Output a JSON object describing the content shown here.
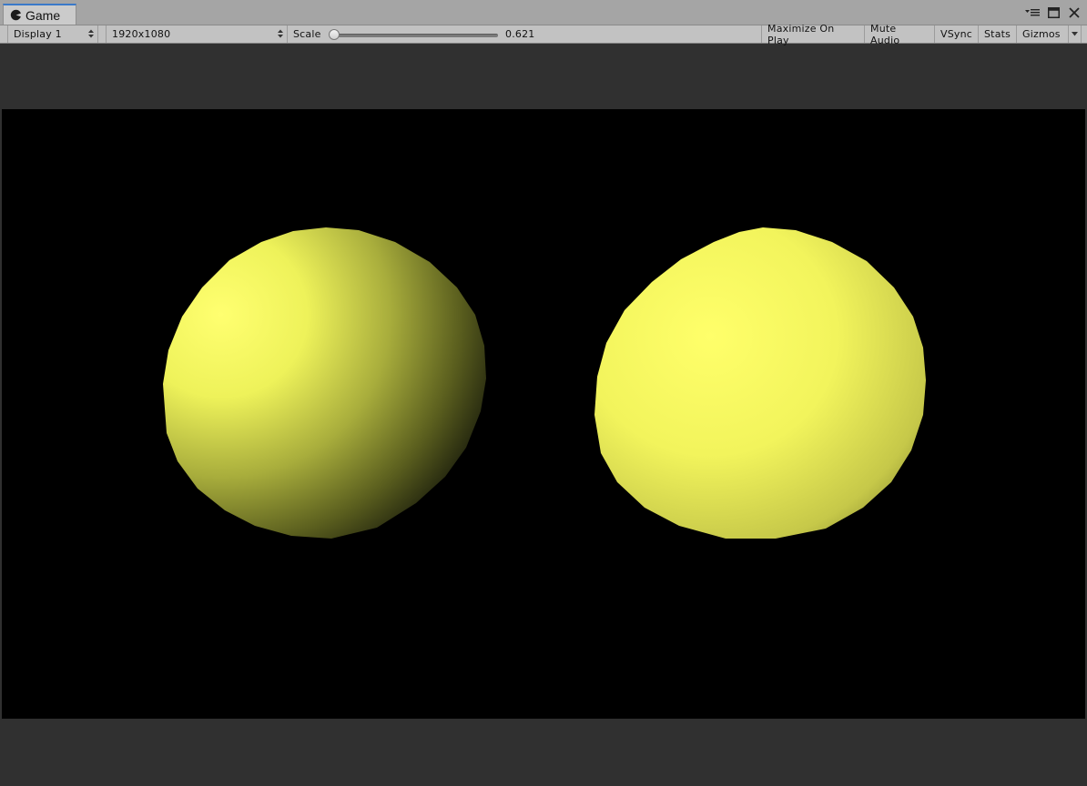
{
  "window": {
    "tab_label": "Game",
    "tab_icon": "pacman-game-icon",
    "controls": [
      "tab-menu-icon",
      "maximize-icon",
      "close-icon"
    ]
  },
  "toolbar": {
    "display": "Display 1",
    "resolution": "1920x1080",
    "scale_label": "Scale",
    "scale_value": "0.621",
    "maximize_on_play": "Maximize On Play",
    "mute_audio": "Mute Audio",
    "vsync": "VSync",
    "stats": "Stats",
    "gizmos": "Gizmos"
  },
  "scene": {
    "background": "#000000",
    "object_color": "#ffff66",
    "objects": [
      "sphere-left",
      "sphere-right"
    ]
  }
}
